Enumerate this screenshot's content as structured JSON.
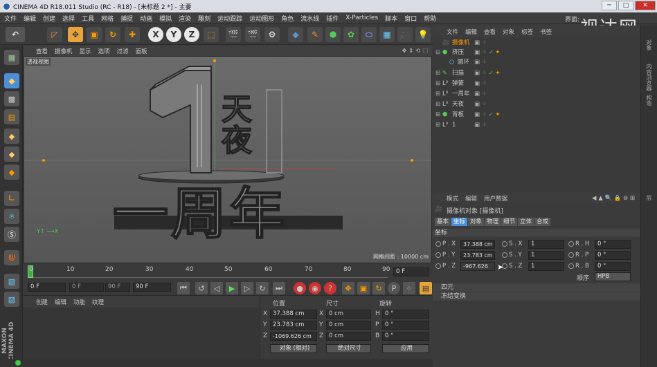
{
  "window": {
    "title": "CINEMA 4D R18.011 Studio (RC - R18) - [未标题 2 *] - 主要"
  },
  "menu": [
    "文件",
    "编辑",
    "创建",
    "选择",
    "工具",
    "网格",
    "捕捉",
    "动画",
    "模拟",
    "渲染",
    "雕刻",
    "运动跟踪",
    "运动图形",
    "角色",
    "流水线",
    "插件",
    "X-Particles",
    "脚本",
    "窗口",
    "帮助"
  ],
  "layout_label": "界面:",
  "watermark": "视达网",
  "toolbar": {
    "x_label": "X",
    "y_label": "Y",
    "z_label": "Z"
  },
  "viewport": {
    "menu": [
      "查看",
      "摄像机",
      "显示",
      "选项",
      "过滤",
      "面板"
    ],
    "label": "透视视图",
    "grid_spacing": "网格间距 : 10000 cm",
    "model_text": {
      "digit": "1",
      "line1": "天",
      "line2": "夜",
      "bottom": "一周年"
    }
  },
  "timeline": {
    "ticks": [
      "0",
      "10",
      "20",
      "30",
      "40",
      "50",
      "60",
      "70",
      "80",
      "90"
    ],
    "current_frame": "0 F",
    "start": "0 F",
    "preview_start": "0 F",
    "preview_end": "90 F",
    "end": "90 F"
  },
  "material": {
    "menu": [
      "创建",
      "编辑",
      "功能",
      "纹理"
    ]
  },
  "coords": {
    "headers": [
      "位置",
      "尺寸",
      "旋转"
    ],
    "rows": [
      {
        "axis": "X",
        "pos": "37.388 cm",
        "size": "0 cm",
        "rot_axis": "H",
        "rot": "0 °"
      },
      {
        "axis": "Y",
        "pos": "23.783 cm",
        "size": "0 cm",
        "rot_axis": "P",
        "rot": "0 °"
      },
      {
        "axis": "Z",
        "pos": "-1069.626 cm",
        "size": "0 cm",
        "rot_axis": "B",
        "rot": "0 °"
      }
    ],
    "mode": "对象 (相对)",
    "size_mode": "绝对尺寸",
    "apply": "应用"
  },
  "objects": {
    "menu": [
      "文件",
      "编辑",
      "查看",
      "对象",
      "标签",
      "书签"
    ],
    "items": [
      {
        "name": "摄像机",
        "indent": 0,
        "selected": true
      },
      {
        "name": "挤压",
        "indent": 0
      },
      {
        "name": "圆环",
        "indent": 1
      },
      {
        "name": "扫描",
        "indent": 0
      },
      {
        "name": "弹簧",
        "indent": 0
      },
      {
        "name": "一周年",
        "indent": 0
      },
      {
        "name": "天夜",
        "indent": 0
      },
      {
        "name": "背板",
        "indent": 0
      },
      {
        "name": "1",
        "indent": 0
      }
    ]
  },
  "attributes": {
    "menu": [
      "模式",
      "编辑",
      "用户数据"
    ],
    "title": "摄像机对象 [摄像机]",
    "tabs": [
      "基本",
      "坐标",
      "对象",
      "物理",
      "细节",
      "立体",
      "合成"
    ],
    "active_tab": "坐标",
    "section": "坐标",
    "rows": [
      {
        "a": "P . X",
        "av": "37.388 cm",
        "b": "S . X",
        "bv": "1",
        "c": "R . H",
        "cv": "0 °"
      },
      {
        "a": "P . Y",
        "av": "23.783 cm",
        "b": "S . Y",
        "bv": "1",
        "c": "R . P",
        "cv": "0 °"
      },
      {
        "a": "P . Z",
        "av": "-967.626",
        "b": "S . Z",
        "bv": "1",
        "c": "R . B",
        "cv": "0 °"
      }
    ],
    "order_label": "顺序",
    "order_value": "HPB",
    "collapsed": [
      "四元",
      "冻结变换"
    ]
  },
  "side_tabs": [
    "对象",
    "内容浏览器",
    "构造",
    "层"
  ],
  "brand": "MAXON CINEMA 4D"
}
